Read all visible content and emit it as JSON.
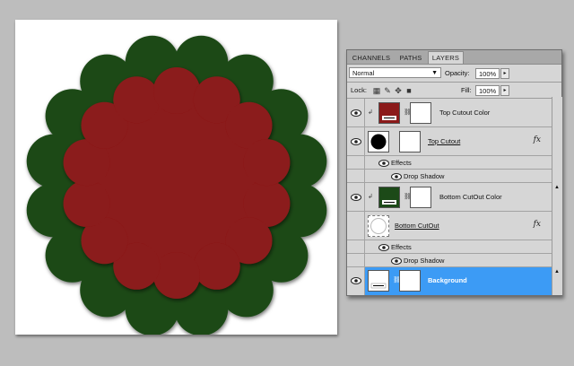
{
  "panel": {
    "tabs": [
      {
        "label": "CHANNELS",
        "active": false
      },
      {
        "label": "PATHS",
        "active": false
      },
      {
        "label": "LAYERS",
        "active": true
      }
    ],
    "blend_mode": "Normal",
    "opacity_label": "Opacity:",
    "opacity_value": "100%",
    "lock_label": "Lock:",
    "fill_label": "Fill:",
    "fill_value": "100%"
  },
  "layers": [
    {
      "name": "Top Cutout Color",
      "type": "fill",
      "color": "#8b1a1a",
      "clipped": true
    },
    {
      "name": "Top Cutout",
      "type": "shape",
      "fx": "fx",
      "effects_label": "Effects",
      "effect": "Drop Shadow"
    },
    {
      "name": "Bottom CutOut Color",
      "type": "fill",
      "color": "#1c4a18",
      "clipped": true
    },
    {
      "name": "Bottom CutOut",
      "type": "shape",
      "fx": "fx",
      "effects_label": "Effects",
      "effect": "Drop Shadow"
    },
    {
      "name": "Background",
      "type": "background",
      "selected": true
    }
  ],
  "colors": {
    "outer_flower": "#1c4a18",
    "inner_flower": "#8b1a1a",
    "selection": "#3c9bf5"
  }
}
